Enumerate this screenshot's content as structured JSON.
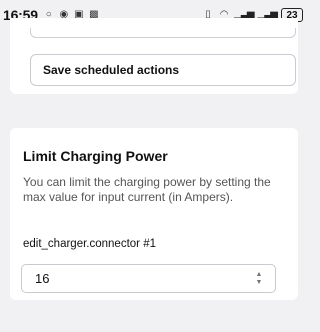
{
  "status_bar": {
    "time": "16:59",
    "notification_icons": [
      "circle-icon",
      "eye-icon",
      "nfc-icon",
      "gallery-icon"
    ],
    "battery": "23"
  },
  "schedule": {
    "save_button_label": "Save scheduled actions"
  },
  "limit_charging": {
    "title": "Limit Charging Power",
    "description": "You can limit the charging power by setting the max value for input current (in Ampers).",
    "connector_label": "edit_charger.connector #1",
    "value": "16"
  }
}
